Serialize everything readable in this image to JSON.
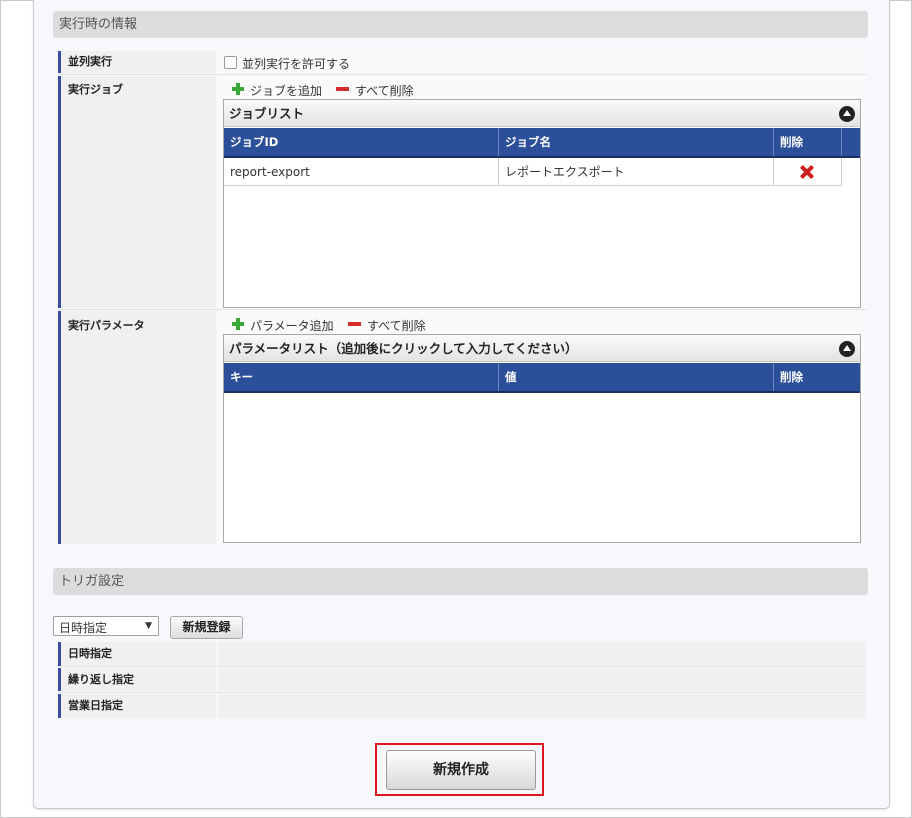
{
  "runtime_section": {
    "title": "実行時の情報",
    "parallel": {
      "label": "並列実行",
      "checkbox_label": "並列実行を許可する",
      "checked": false
    },
    "jobs": {
      "label": "実行ジョブ",
      "add_label": "ジョブを追加",
      "delete_all_label": "すべて削除",
      "grid_title": "ジョブリスト",
      "columns": [
        "ジョブID",
        "ジョブ名",
        "削除"
      ],
      "rows": [
        {
          "id": "report-export",
          "name": "レポートエクスポート"
        }
      ]
    },
    "params": {
      "label": "実行パラメータ",
      "add_label": "パラメータ追加",
      "delete_all_label": "すべて削除",
      "grid_title": "パラメータリスト（追加後にクリックして入力してください）",
      "columns": [
        "キー",
        "値",
        "削除"
      ]
    }
  },
  "trigger_section": {
    "title": "トリガ設定",
    "select_value": "日時指定",
    "register_button": "新規登録",
    "rows": [
      "日時指定",
      "繰り返し指定",
      "営業日指定"
    ]
  },
  "create_button": "新規作成",
  "colors": {
    "accent": "#2c4f99",
    "highlight": "#e0141e",
    "add": "#3aa935",
    "delete": "#cc1f1f"
  }
}
